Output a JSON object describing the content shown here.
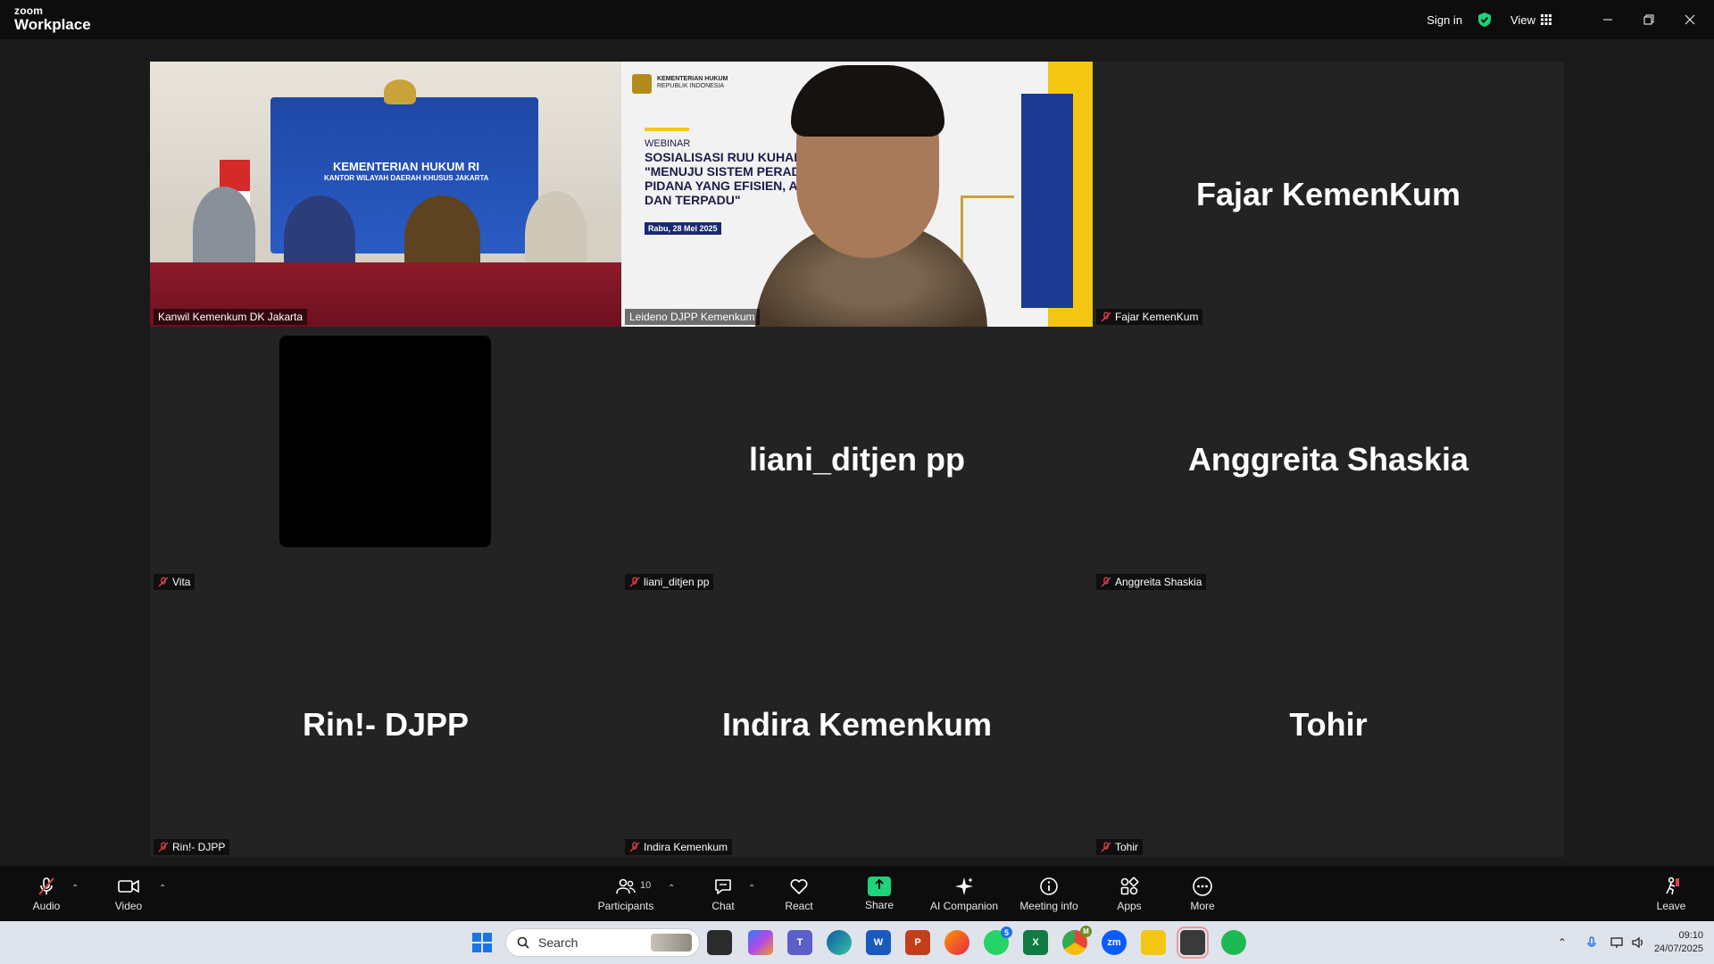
{
  "titlebar": {
    "logo_top": "zoom",
    "logo_bottom": "Workplace",
    "sign_in": "Sign in",
    "view": "View"
  },
  "tiles": [
    {
      "label": "Kanwil Kemenkum DK Jakarta",
      "big": "",
      "muted": false
    },
    {
      "label": "Leideno DJPP Kemenkum",
      "big": "",
      "muted": false
    },
    {
      "label": "Fajar KemenKum",
      "big": "Fajar KemenKum",
      "muted": true
    },
    {
      "label": "Vita",
      "big": "",
      "muted": true
    },
    {
      "label": "liani_ditjen pp",
      "big": "liani_ditjen pp",
      "muted": true
    },
    {
      "label": "Anggreita Shaskia",
      "big": "Anggreita Shaskia",
      "muted": true
    },
    {
      "label": "Rin!- DJPP",
      "big": "Rin!- DJPP",
      "muted": true
    },
    {
      "label": "Indira Kemenkum",
      "big": "Indira Kemenkum",
      "muted": true
    },
    {
      "label": "Tohir",
      "big": "Tohir",
      "muted": true
    }
  ],
  "room_banner": {
    "line1": "KEMENTERIAN HUKUM RI",
    "line2": "KANTOR WILAYAH DAERAH KHUSUS JAKARTA"
  },
  "slide": {
    "org1": "KEMENTERIAN HUKUM",
    "org2": "REPUBLIK INDONESIA",
    "kicker": "WEBINAR",
    "title1": "SOSIALISASI RUU KUHAP:",
    "title2": "\"MENUJU SISTEM PERAD",
    "title3": "PIDANA YANG EFISIEN, A",
    "title4": "DAN TERPADU\"",
    "date": "Rabu, 28 Mei 2025"
  },
  "toolbar": {
    "audio": "Audio",
    "video": "Video",
    "participants": "Participants",
    "participants_count": "10",
    "chat": "Chat",
    "react": "React",
    "share": "Share",
    "ai": "AI Companion",
    "meeting_info": "Meeting info",
    "apps": "Apps",
    "more": "More",
    "leave": "Leave"
  },
  "taskbar": {
    "search": "Search",
    "time": "09:10",
    "date": "24/07/2025",
    "whatsapp_badge": "5",
    "chrome_badge": "M"
  },
  "colors": {
    "active_speaker": "#1ed37a",
    "muted_red": "#e0404a",
    "share_green": "#1ed37a"
  }
}
